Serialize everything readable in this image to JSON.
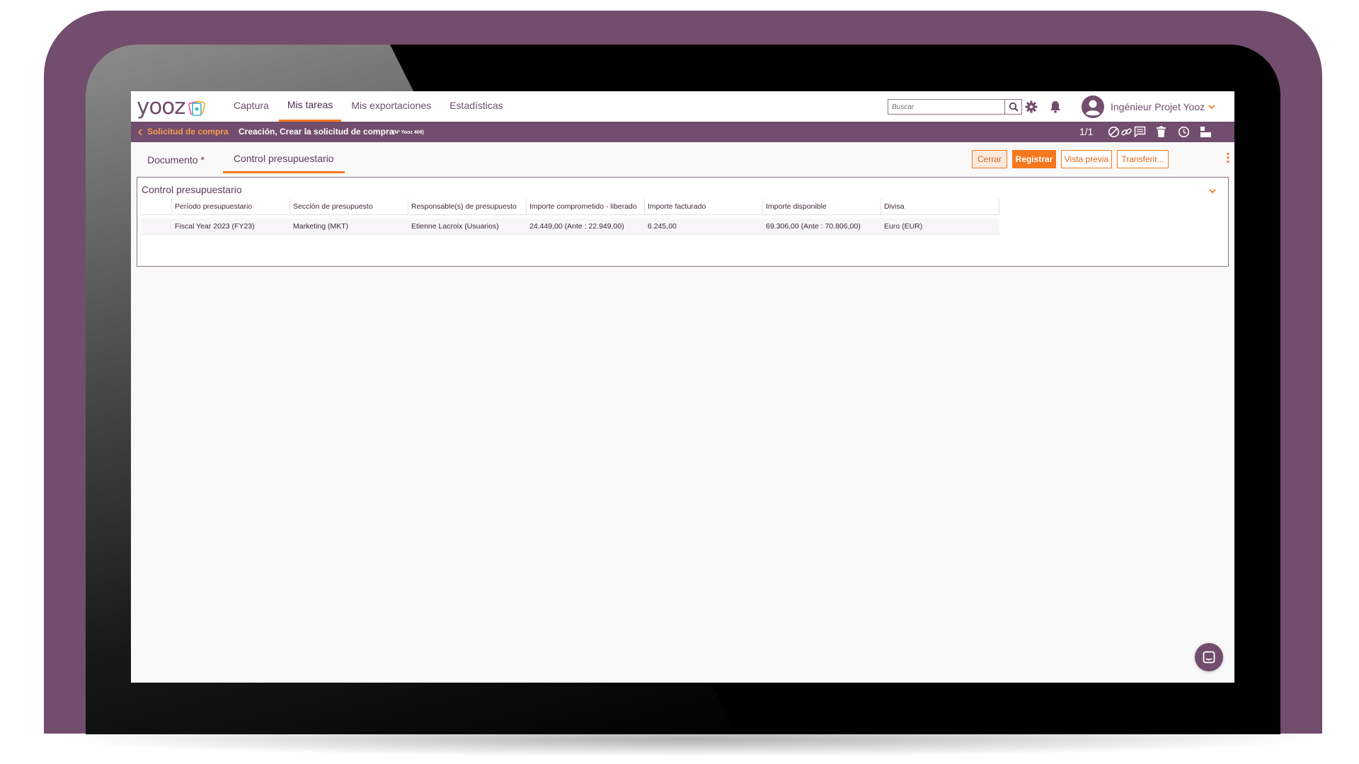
{
  "brand": {
    "logo_text": "yooz"
  },
  "nav": {
    "items": [
      "Captura",
      "Mis tareas",
      "Mis exportaciones",
      "Estadísticas"
    ],
    "active_index": 1
  },
  "search": {
    "placeholder": "Buscar"
  },
  "user": {
    "name": "Ingénieur Projet Yooz"
  },
  "subbar": {
    "back_label": "Solicitud de compra",
    "title": "Creación, Crear la solicitud de compra",
    "doc_id": "(Nº Yooz 408)",
    "pager": "1/1"
  },
  "tabs": {
    "items": [
      "Documento *",
      "Control presupuestario"
    ],
    "active_index": 1
  },
  "actions": {
    "close": "Cerrar",
    "save": "Registrar",
    "preview": "Vista previa",
    "transfer": "Transferir..."
  },
  "panel": {
    "title": "Control presupuestario",
    "columns": [
      "Período presupuestario",
      "Sección de presupuesto",
      "Responsable(s) de presupuesto",
      "Importe comprometido - liberado",
      "Importe facturado",
      "Importe disponible",
      "Divisa"
    ],
    "rows": [
      [
        "Fiscal Year 2023 (FY23)",
        "Marketing (MKT)",
        "Etienne Lacroix (Usuarios)",
        "24.449,00 (Ante : 22.949,00)",
        "6.245,00",
        "69.306,00 (Ante : 70.806,00)",
        "Euro (EUR)"
      ]
    ]
  },
  "colors": {
    "brand": "#724d6d",
    "accent": "#f5781f",
    "back_link": "#f59a50"
  },
  "icons": [
    "search-icon",
    "gear-icon",
    "bell-icon",
    "user-avatar-icon",
    "chevron-down-icon",
    "chevron-left-icon",
    "block-icon",
    "link-icon",
    "comment-icon",
    "trash-icon",
    "clock-icon",
    "layout-icon",
    "kebab-icon",
    "chat-icon"
  ]
}
